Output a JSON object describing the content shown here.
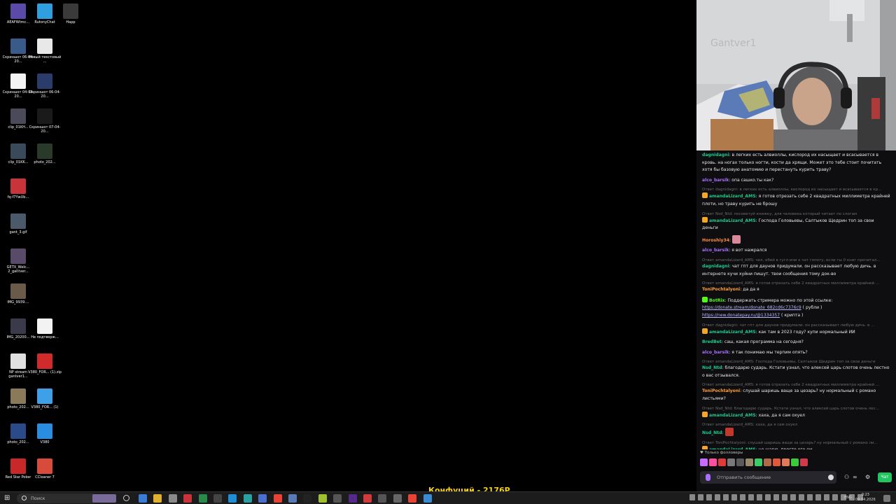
{
  "desktop": {
    "icons": [
      {
        "label": "AEAFWtmc...",
        "color": "#5b4aa8"
      },
      {
        "label": "RutonyChat",
        "color": "#2f9fe0"
      },
      {
        "label": "Happ",
        "color": "#3a3a3a"
      },
      {
        "label": "Скриншот 06-04-20...",
        "color": "#3a5a8a"
      },
      {
        "label": "Новый текстовый ...",
        "color": "#e8e8e8"
      },
      {
        "label": "Скриншот 04-04-20...",
        "color": "#f4f4f4"
      },
      {
        "label": "Скриншот 06-04-20...",
        "color": "#2a3c6a"
      },
      {
        "label": "clip_01KH...",
        "color": "#4a4a5a"
      },
      {
        "label": "Скриншот 07-04-20...",
        "color": "#1a1a1a"
      },
      {
        "label": "clip_01KK...",
        "color": "#3a4a5a"
      },
      {
        "label": "photo_202...",
        "color": "#2a3a2a"
      },
      {
        "label": "fq-f7YwUb...",
        "color": "#c8343a"
      },
      {
        "label": "gant_3.gif",
        "color": "#4a5a6a"
      },
      {
        "label": "GETX_Welc... 2_gantver...",
        "color": "#5a4a6a"
      },
      {
        "label": "IMG_9939....",
        "color": "#6a5a4a"
      },
      {
        "label": "IMG_20200...",
        "color": "#3a3a4a"
      },
      {
        "label": "Не подтверж...",
        "color": "#f2f2f2"
      },
      {
        "label": "NP stream gantver1...",
        "color": "#e0e0e0"
      },
      {
        "label": "V380_FOR... (1).zip",
        "color": "#d02a2a"
      },
      {
        "label": "photo_202...",
        "color": "#8a7a5a"
      },
      {
        "label": "V380_FOR... (1)",
        "color": "#3fa0e8"
      },
      {
        "label": "photo_202...",
        "color": "#2a4a8a"
      },
      {
        "label": "V380",
        "color": "#2a8ee0"
      },
      {
        "label": "Red Star Poker",
        "color": "#c8282a"
      },
      {
        "label": "CCleaner 7",
        "color": "#d84a3a"
      }
    ]
  },
  "chat": {
    "messages": [
      {
        "user": "dagnidagni",
        "color": "#1fc98a",
        "text": "в легких есть алвиоллы, кислород их насыщает и всасывается в кровь. на ногах только ногти, кости да хрящи. Может это тебе стоит почитать хотя бы базовую анатомию и перестануть курить траву?"
      },
      {
        "user": "alco_barsik",
        "color": "#a970ff",
        "text": "опа сашко.ты как?"
      },
      {
        "reply": "Ответ dagnidagni: в легких есть алвиоллы, кислород их насыщает и всасывается в кр...",
        "user": "amandaLizard_AMS",
        "color": "#1fc98a",
        "badge": "#f5a623",
        "text": "я готов отрезать себе 2 квадратных миллиметра крайней плоти, но траву курить не брошу"
      },
      {
        "reply": "Ответ Nsd_Ntd: посоветуй книжку, для человека который читает по слогам",
        "user": "amandaLizard_AMS",
        "color": "#1fc98a",
        "badge": "#f5a623",
        "text": "Господа Головьевы, Салтыков Щедрин топ за свои деньги"
      },
      {
        "user": "Horoshiy34",
        "color": "#ff8c42",
        "text": "",
        "emote": "#d9899a"
      },
      {
        "user": "alco_barsik",
        "color": "#a970ff",
        "text": "я вот нажрался"
      },
      {
        "reply": "Ответ amandaLizard_AMS: чел, ебей в гугл или к чат гопоту, если ты 0 книг прочитал...",
        "user": "dagnidagni",
        "color": "#1fc98a",
        "text": "чат гпт для даунов придумали. он рассказывает любую дичь. в интернете кучи хуйни пишут. твои сообщения тому док-во"
      },
      {
        "reply": "Ответ amandaLizard_AMS: я готов отрезать себе 2 квадратных миллиметра крайней ...",
        "user": "ToniPochtalyoni",
        "color": "#ff9f3a",
        "text": "да да я"
      },
      {
        "user": "BotRix",
        "color": "#53fc18",
        "badge": "#53fc18",
        "text": "Поддержать стримера можно по этой ссылке:",
        "link1": "https://donate.stream/donate_682cd6c7376c9",
        "link1_suffix": "( рубли )",
        "link2": "https://new.donatepay.ru/@1334357",
        "link2_suffix": "( крипта )"
      },
      {
        "reply": "Ответ dagnidagni: чат гпт для даунов придумали. он рассказывает любую дичь. в ...",
        "user": "amandaLizard_AMS",
        "color": "#1fc98a",
        "badge": "#f5a623",
        "text": "как там в 2023 году? купи нормальный ИИ"
      },
      {
        "user": "BredBet",
        "color": "#1fc98a",
        "text": "саш, какая программа на сегодня?"
      },
      {
        "user": "alco_barsik",
        "color": "#a970ff",
        "text": "я так понимаю мы терпим опять?"
      },
      {
        "reply": "Ответ amandaLizard_AMS: Господа Головьевы, Салтыков Щедрин топ за свои деньги",
        "user": "Nsd_Ntd",
        "color": "#1fc98a",
        "text": "благодарю сударь. Кстати узнал, что алексей царь слотов очень лестно о вас отзывался."
      },
      {
        "reply": "Ответ amandaLizard_AMS: я готов отрезать себе 2 квадратных миллиметра крайней ...",
        "user": "ToniPochtalyoni",
        "color": "#ff9f3a",
        "text": "слушай шаришь ваще за цезарь? ну нормальный с романо листьями?"
      },
      {
        "reply": "Ответ Nsd_Ntd: благодарю сударь. Кстати узнал, что алексей царь слотов очень лес...",
        "user": "amandaLizard_AMS",
        "color": "#1fc98a",
        "badge": "#f5a623",
        "text": "хаха, да я сам охуел"
      },
      {
        "reply": "Ответ amandaLizard_AMS: хаха, да я сам охуел",
        "user": "Nsd_Ntd",
        "color": "#1fc98a",
        "text": "",
        "emote": "#c0392b"
      },
      {
        "reply": "Ответ ToniPochtalyoni: слушай шаришь ваще за цезарь? ну нормальный с романо ли...",
        "user": "amandaLizard_AMS",
        "color": "#1fc98a",
        "badge": "#f5a623",
        "text": "не шарю, просто его ем"
      }
    ],
    "followers_only": "Только фолловеры",
    "emote_colors": [
      "#c86bff",
      "#ff4fa3",
      "#e03a3a",
      "#7a7a7a",
      "#5a5a5a",
      "#9a8a6a",
      "#3acb6a",
      "#b06a4a",
      "#e05a3a",
      "#e07a5a",
      "#3acb3a",
      "#d03a4a"
    ],
    "input_placeholder": "Отправить сообщение",
    "send_label": "Чат"
  },
  "overlay_text": "Конфуций - 2176Р",
  "taskbar": {
    "search_placeholder": "Поиск",
    "lang": "ENG",
    "time": "0:23",
    "date": "09.04.2026"
  }
}
